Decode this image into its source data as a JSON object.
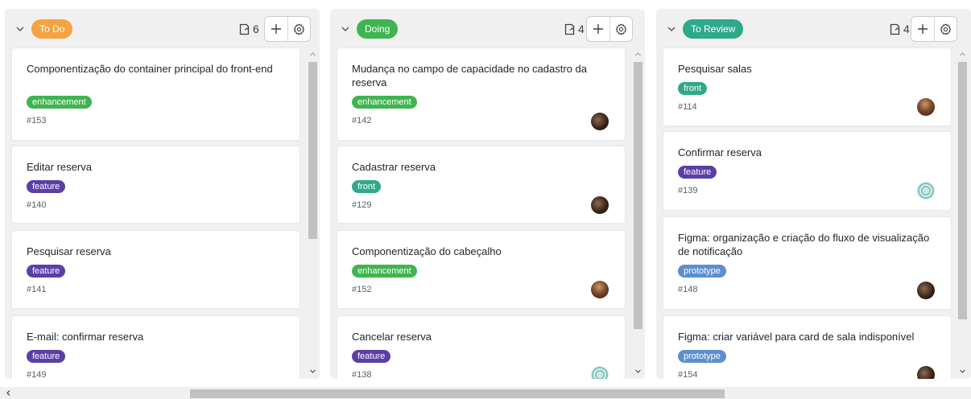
{
  "columns": [
    {
      "label": "To Do",
      "label_color": "#f4a340",
      "count": "6",
      "cards": [
        {
          "title": "Componentização do container principal do front-end",
          "tag": "enhancement",
          "tag_color": "#3fb54f",
          "number": "#153",
          "avatar": null
        },
        {
          "title": "Editar reserva",
          "tag": "feature",
          "tag_color": "#5b3ea8",
          "number": "#140",
          "avatar": null
        },
        {
          "title": "Pesquisar reserva",
          "tag": "feature",
          "tag_color": "#5b3ea8",
          "number": "#141",
          "avatar": null
        },
        {
          "title": "E-mail: confirmar reserva",
          "tag": "feature",
          "tag_color": "#5b3ea8",
          "number": "#149",
          "avatar": null
        }
      ]
    },
    {
      "label": "Doing",
      "label_color": "#3fb54f",
      "count": "4",
      "cards": [
        {
          "title": "Mudança no campo de capacidade no cadastro da reserva",
          "tag": "enhancement",
          "tag_color": "#3fb54f",
          "number": "#142",
          "avatar": "dark"
        },
        {
          "title": "Cadastrar reserva",
          "tag": "front",
          "tag_color": "#2ea98a",
          "number": "#129",
          "avatar": "dark"
        },
        {
          "title": "Componentização do cabeçalho",
          "tag": "enhancement",
          "tag_color": "#3fb54f",
          "number": "#152",
          "avatar": "brown"
        },
        {
          "title": "Cancelar reserva",
          "tag": "feature",
          "tag_color": "#5b3ea8",
          "number": "#138",
          "avatar": "teal"
        }
      ]
    },
    {
      "label": "To Review",
      "label_color": "#2ea98a",
      "count": "4",
      "cards": [
        {
          "title": "Pesquisar salas",
          "tag": "front",
          "tag_color": "#2ea98a",
          "number": "#114",
          "avatar": "brown"
        },
        {
          "title": "Confirmar reserva",
          "tag": "feature",
          "tag_color": "#5b3ea8",
          "number": "#139",
          "avatar": "teal"
        },
        {
          "title": "Figma: organização e criação do fluxo de visualização de notificação",
          "tag": "prototype",
          "tag_color": "#5b8fd0",
          "number": "#148",
          "avatar": "dark"
        },
        {
          "title": "Figma: criar variável para card de sala indisponível",
          "tag": "prototype",
          "tag_color": "#5b8fd0",
          "number": "#154",
          "avatar": "dark"
        }
      ]
    }
  ],
  "icons": {
    "collapse": "chevron-down-icon",
    "count": "card-count-icon",
    "add": "plus-icon",
    "settings": "gear-icon",
    "scroll_up": "chevron-up-icon",
    "scroll_down": "chevron-down-icon",
    "scroll_left": "chevron-left-icon"
  }
}
